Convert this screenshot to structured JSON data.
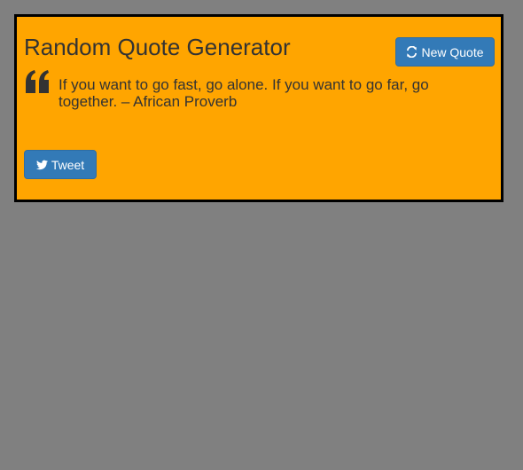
{
  "app": {
    "title": "Random Quote Generator"
  },
  "toolbar": {
    "new_quote_label": "New Quote",
    "new_quote_icon": "refresh-icon"
  },
  "quote": {
    "icon": "quote-left-icon",
    "text": "If you want to go fast, go alone. If you want to go far, go together. – African Proverb"
  },
  "share": {
    "tweet_label": "Tweet",
    "tweet_icon": "twitter-icon"
  },
  "colors": {
    "page_background": "#808080",
    "card_background": "#FFA500",
    "card_border": "#000000",
    "button": "#337ab7",
    "text": "#333333"
  }
}
